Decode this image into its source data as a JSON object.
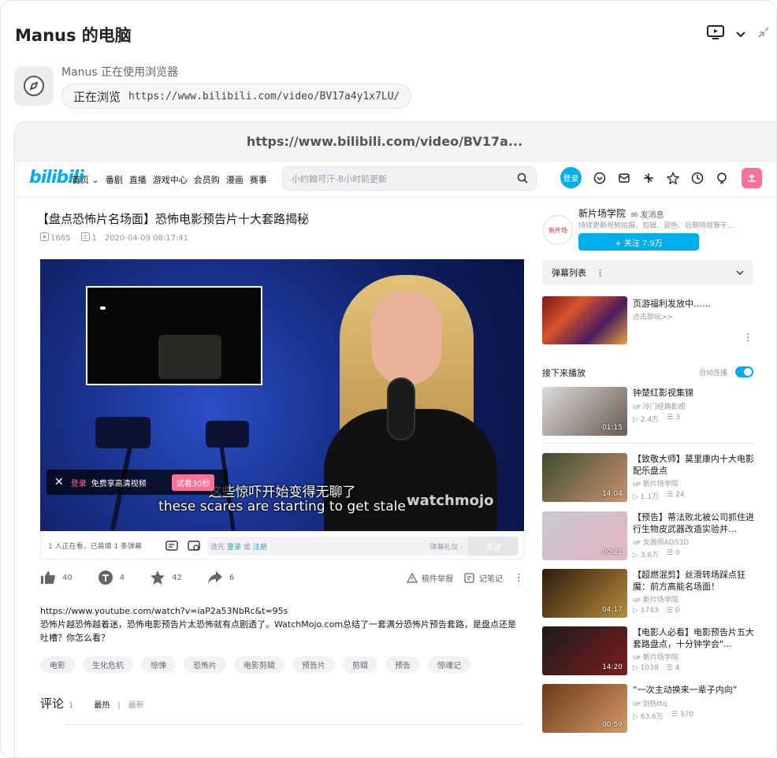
{
  "header": {
    "title": "Manus 的电脑"
  },
  "agent": {
    "status": "Manus 正在使用浏览器",
    "action": "正在浏览",
    "url": "https://www.bilibili.com/video/BV17a4y1x7LU/"
  },
  "frame": {
    "url": "https://www.bilibili.com/video/BV17a..."
  },
  "nav": {
    "logo": "bilibili",
    "links": [
      "首页 ⌄",
      "番剧",
      "直播",
      "游戏中心",
      "会员购",
      "漫画",
      "赛事"
    ],
    "search_placeholder": "小约翰可汗-8小时前更新",
    "login": "登录"
  },
  "video": {
    "title": "【盘点恐怖片名场面】恐怖电影预告片十大套路揭秘",
    "plays": "1685",
    "danmaku": "1",
    "date": "2020-04-09 08:17:41",
    "subtitle_cn": "这些惊吓开始变得无聊了",
    "subtitle_en": "these scares are starting to get stale",
    "watermark": "watchmojo",
    "login_banner": {
      "login": "登录",
      "text": "免费享高清视频",
      "trial": "试看30秒"
    }
  },
  "danmaku_bar": {
    "viewers": "1 人正在看，已装填 1 条弹幕",
    "please": "请先",
    "login": "登录",
    "or": "或",
    "register": "注册",
    "gift": "弹幕礼仪 ›",
    "send": "发送"
  },
  "toolbar": {
    "like": "40",
    "coin": "4",
    "fav": "42",
    "share": "6",
    "report": "稿件举报",
    "notes": "记笔记"
  },
  "description": {
    "link": "https://www.youtube.com/watch?v=iaP2a53NbRc&t=95s",
    "text": "恐怖片越恐怖越着迷，恐怖电影预告片太恐怖就有点剧透了。WatchMojo.com总结了一套满分恐怖片预告套路，是盘点还是吐槽？你怎么看？"
  },
  "tags": [
    "电影",
    "生化危机",
    "惊悚",
    "恐怖片",
    "电影剪辑",
    "预告片",
    "剪辑",
    "预告",
    "惊魂记"
  ],
  "comments": {
    "label": "评论",
    "count": "1",
    "hot": "最热",
    "sep": "|",
    "new": "最新"
  },
  "uploader": {
    "avatar_text": "新片场",
    "name": "新片场学院",
    "message": "发消息",
    "desc": "持续更新视频拍摄、剪辑、调色、后期特效等干...",
    "follow": "+ 关注 7.9万"
  },
  "danmaku_list": {
    "label": "弹幕列表",
    "menu": "⋮"
  },
  "ad": {
    "title": "页游福利发放中……",
    "sub": "点击即玩>>",
    "more": "⋮"
  },
  "next": {
    "label": "接下来播放",
    "autoplay": "自动连播"
  },
  "recommend": [
    {
      "title": "钟楚红影视集锦",
      "author": "冷门经典影视",
      "views": "2.4万",
      "danmaku": "3",
      "duration": "01:15",
      "color1": "#dbdbdb",
      "color2": "#6b5a52"
    },
    {
      "title": "【致敬大师】莫里康内十大电影配乐盘点",
      "author": "新片场学院",
      "views": "1.1万",
      "danmaku": "24",
      "duration": "14:04",
      "color1": "#3d4e2f",
      "color2": "#c99070"
    },
    {
      "title": "【预告】蒂法败北被公司抓住进行生物皮武器改造实验并…",
      "author": "女画师ADS3D",
      "views": "3.6万",
      "danmaku": "0",
      "duration": "00:21",
      "color1": "#c7c9cf",
      "color2": "#e6b4c4"
    },
    {
      "title": "【超燃混剪】丝滑转场踩点狂魔：前方高能名场面！",
      "author": "新片场学院",
      "views": "1743",
      "danmaku": "0",
      "duration": "04:17",
      "color1": "#2b1d0e",
      "color2": "#b98a3a"
    },
    {
      "title": "【电影人必看】电影预告片五大套路盘点，十分钟学会\"…",
      "author": "新片场学院",
      "views": "1038",
      "danmaku": "4",
      "duration": "14:20",
      "color1": "#1b1b1b",
      "color2": "#7c1d1d"
    },
    {
      "title": "“一次主动换来一辈子内向”",
      "author": "剑伤ttq",
      "views": "63.6万",
      "danmaku": "370",
      "duration": "00:59",
      "color1": "#6b3a1a",
      "color2": "#d49a64"
    }
  ]
}
